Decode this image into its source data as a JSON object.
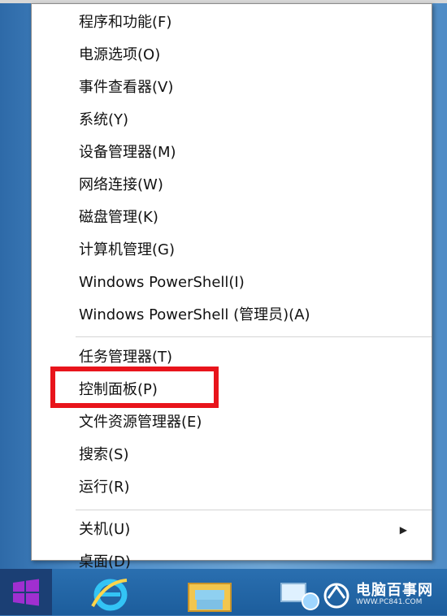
{
  "menu": {
    "group1": [
      {
        "label": "程序和功能(F)"
      },
      {
        "label": "电源选项(O)"
      },
      {
        "label": "事件查看器(V)"
      },
      {
        "label": "系统(Y)"
      },
      {
        "label": "设备管理器(M)"
      },
      {
        "label": "网络连接(W)"
      },
      {
        "label": "磁盘管理(K)"
      },
      {
        "label": "计算机管理(G)"
      },
      {
        "label": "Windows PowerShell(I)"
      },
      {
        "label": "Windows PowerShell (管理员)(A)"
      }
    ],
    "group2": [
      {
        "label": "任务管理器(T)"
      },
      {
        "label": "控制面板(P)"
      },
      {
        "label": "文件资源管理器(E)"
      },
      {
        "label": "搜索(S)"
      },
      {
        "label": "运行(R)"
      }
    ],
    "group3": [
      {
        "label": "关机(U)",
        "has_submenu": true
      },
      {
        "label": "桌面(D)"
      }
    ],
    "submenu_arrow": "▶",
    "highlighted_item": "控制面板(P)",
    "highlight_color": "#e8141b"
  },
  "taskbar": {
    "icons": [
      "windows-start-icon",
      "internet-explorer-icon",
      "file-explorer-icon",
      "network-icon"
    ]
  },
  "watermark": {
    "text": "电脑百事网",
    "url": "WWW.PC841.COM"
  }
}
